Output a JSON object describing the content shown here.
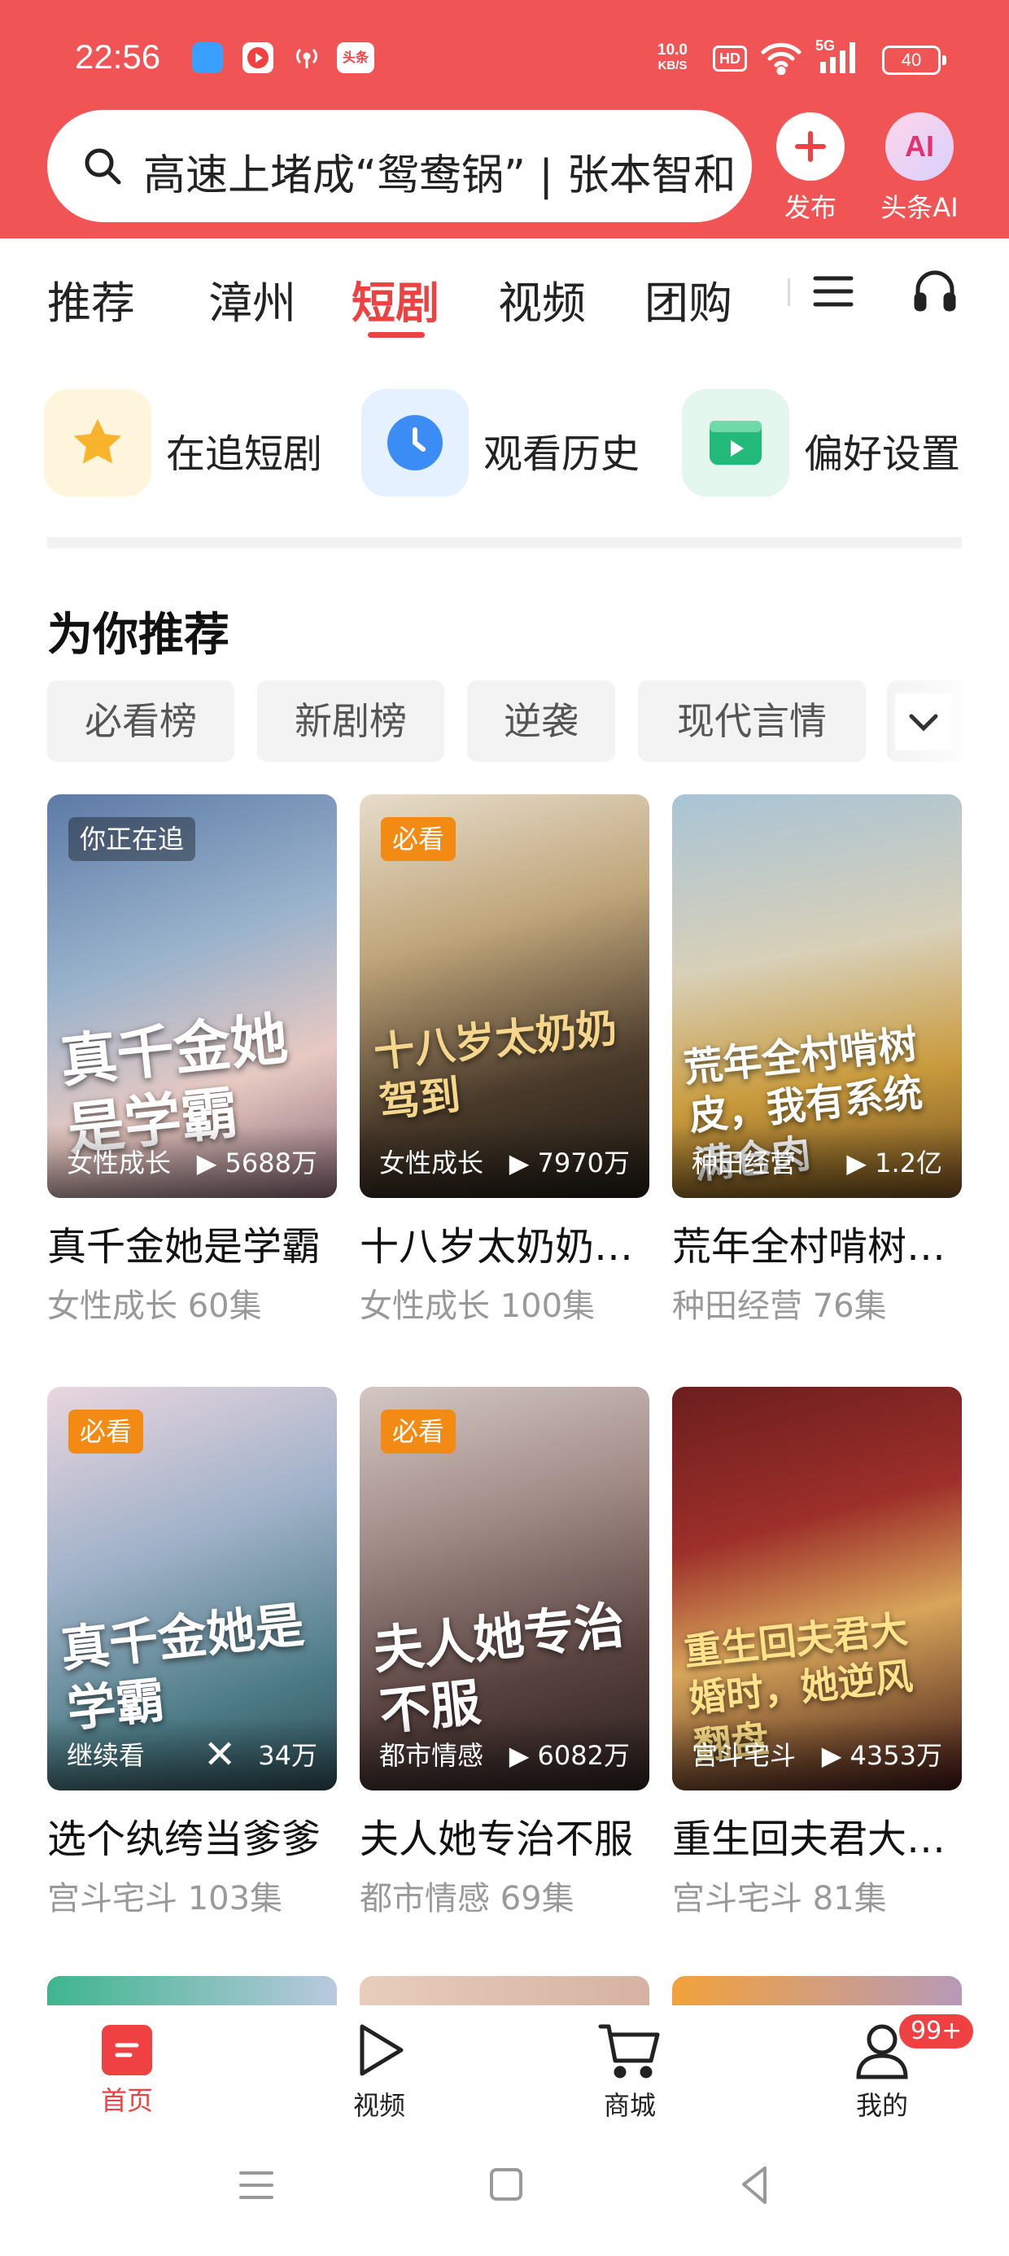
{
  "status_bar": {
    "time": "22:56",
    "net_speed_value": "10.0",
    "net_speed_unit": "KB/S",
    "hd_label": "HD",
    "network": "5G",
    "battery": "40",
    "app_badge": "头条"
  },
  "header": {
    "search_text": "高速上堵成“鸳鸯锅” | 张本智和",
    "publish_label": "发布",
    "ai_label": "头条AI",
    "ai_icon_text": "AI"
  },
  "tabs": {
    "items": [
      "推荐",
      "漳州",
      "短剧",
      "视频",
      "团购"
    ],
    "active": "短剧"
  },
  "quick_actions": [
    {
      "label": "在追短剧",
      "icon": "star-icon"
    },
    {
      "label": "观看历史",
      "icon": "clock-icon"
    },
    {
      "label": "偏好设置",
      "icon": "play-box-icon"
    }
  ],
  "section": {
    "title": "为你推荐",
    "chips": [
      "必看榜",
      "新剧榜",
      "逆袭",
      "现代言情"
    ]
  },
  "dramas": [
    {
      "badge": "你正在追",
      "poster_title": "真千金她是学霸",
      "genre": "女性成长",
      "views": "▶ 5688万",
      "title": "真千金她是学霸",
      "subtitle": "女性成长  60集"
    },
    {
      "badge": "必看",
      "poster_title": "十八岁太奶奶驾到",
      "genre": "女性成长",
      "views": "▶ 7970万",
      "title": "十八岁太奶奶驾到，重整家族荣耀",
      "subtitle": "女性成长  100集"
    },
    {
      "badge": "",
      "poster_title": "荒年全村啃树皮，我有系统满仓肉",
      "genre": "种田经营",
      "views": "▶ 1.2亿",
      "title": "荒年全村啃树皮，我有系统满仓肉",
      "subtitle": "种田经营  76集"
    },
    {
      "badge": "必看",
      "poster_title": "真千金她是学霸",
      "genre": "继续看",
      "views": "34万",
      "title": "选个纨绔当爹爹",
      "subtitle": "宫斗宅斗  103集"
    },
    {
      "badge": "必看",
      "poster_title": "夫人她专治不服",
      "genre": "都市情感",
      "views": "▶ 6082万",
      "title": "夫人她专治不服",
      "subtitle": "都市情感  69集"
    },
    {
      "badge": "",
      "poster_title": "重生回夫君大婚时，她逆风翻盘",
      "genre": "宫斗宅斗",
      "views": "▶ 4353万",
      "title": "重生回夫君大婚时，她逆风翻盘",
      "subtitle": "宫斗宅斗  81集"
    }
  ],
  "bottom_nav": {
    "items": [
      {
        "label": "首页",
        "icon": "home-icon"
      },
      {
        "label": "视频",
        "icon": "play-icon"
      },
      {
        "label": "商城",
        "icon": "cart-icon"
      },
      {
        "label": "我的",
        "icon": "person-icon"
      }
    ],
    "badge": "99+"
  },
  "colors": {
    "brand": "#f05454",
    "active_tab": "#f04142",
    "badge_orange": "#f28a13"
  }
}
